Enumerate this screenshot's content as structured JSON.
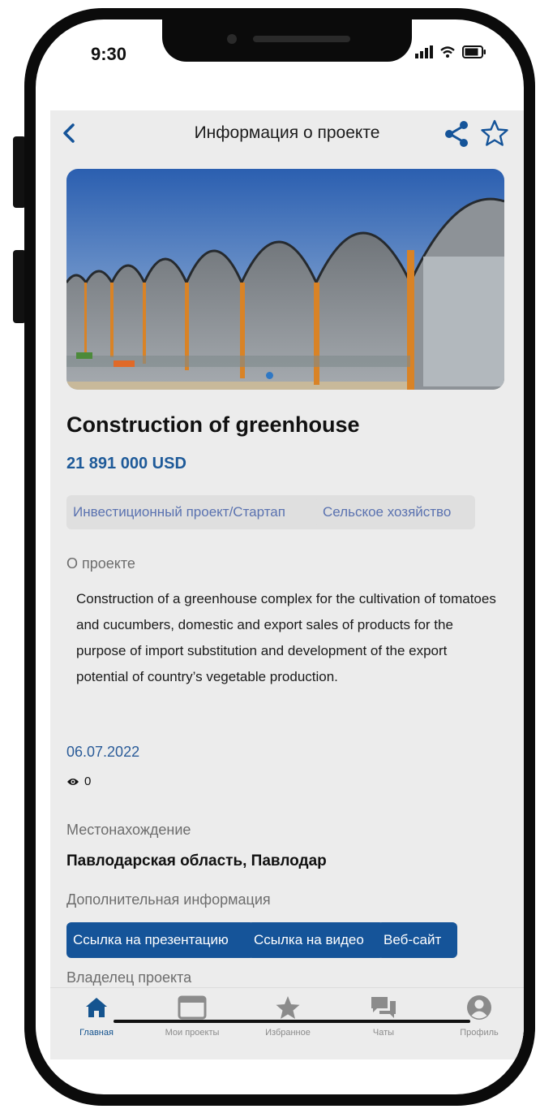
{
  "status_bar": {
    "time": "9:30"
  },
  "header": {
    "title": "Информация о проекте"
  },
  "project": {
    "name": "Construction of greenhouse",
    "price": "21 891 000  USD",
    "tags": [
      "Инвестиционный проект/Стартап",
      "Сельское хозяйство"
    ],
    "about_label": "О проекте",
    "description": "Construction of a greenhouse complex for the cultivation of tomatoes and cucumbers, domestic and export sales of products for the purpose of import substitution and development of the export potential of country’s vegetable production.",
    "date": "06.07.2022",
    "views": "0",
    "location_label": "Местонахождение",
    "location": "Павлодарская область, Павлодар",
    "additional_label": "Дополнительная информация",
    "links": [
      "Ссылка на презентацию",
      "Ссылка на видео",
      "Веб-сайт"
    ],
    "owner_label": "Владелец проекта"
  },
  "tabbar": {
    "items": [
      {
        "label": "Главная",
        "icon": "home-icon"
      },
      {
        "label": "Мои проекты",
        "icon": "window-icon"
      },
      {
        "label": "Избранное",
        "icon": "star-icon"
      },
      {
        "label": "Чаты",
        "icon": "chat-icon"
      },
      {
        "label": "Профиль",
        "icon": "profile-icon"
      }
    ],
    "active_index": 0
  },
  "colors": {
    "accent": "#155499",
    "price": "#1e5a99",
    "tag_text": "#5a72b0",
    "background": "#ececec"
  }
}
